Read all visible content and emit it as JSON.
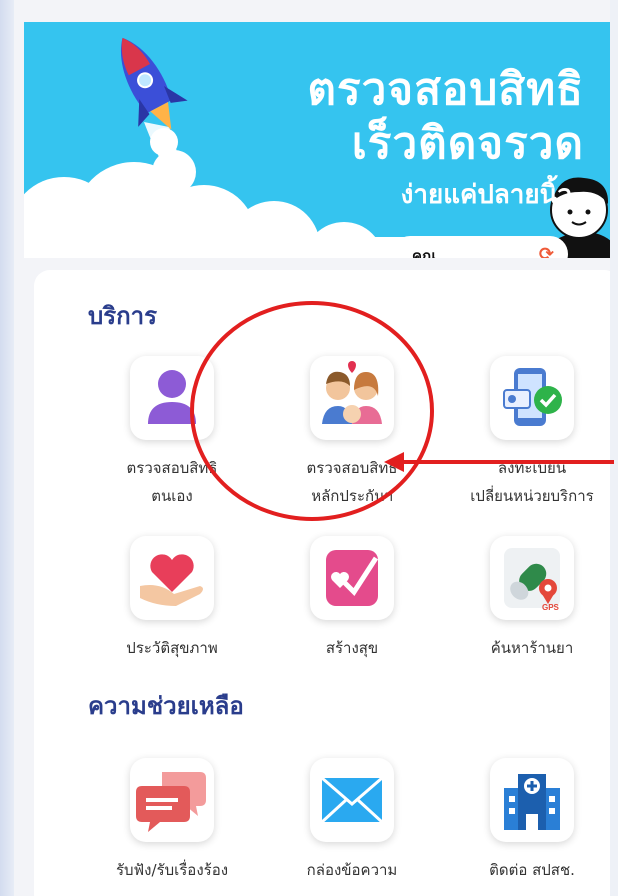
{
  "banner": {
    "title_line1": "ตรวจสอบสิทธิ",
    "title_line2": "เร็วติดจรวด",
    "subtitle": "ง่ายแค่ปลายนิ้ว",
    "pill_text": "คุณ...",
    "pill_icon": "refresh-icon"
  },
  "services": {
    "title": "บริการ",
    "items": [
      {
        "line1": "ตรวจสอบสิทธิ",
        "line2": "ตนเอง",
        "icon": "person-icon"
      },
      {
        "line1": "ตรวจสอบสิทธิ",
        "line2": "หลักประกันฯ",
        "icon": "family-icon"
      },
      {
        "line1": "ลงทะเบียน",
        "line2": "เปลี่ยนหน่วยบริการ",
        "icon": "phone-id-check-icon"
      },
      {
        "line1": "ประวัติสุขภาพ",
        "line2": "",
        "icon": "heart-hand-icon"
      },
      {
        "line1": "สร้างสุข",
        "line2": "",
        "icon": "heart-check-icon"
      },
      {
        "line1": "ค้นหาร้านยา",
        "line2": "",
        "icon": "pill-gps-icon"
      }
    ]
  },
  "help": {
    "title": "ความช่วยเหลือ",
    "items": [
      {
        "line1": "รับฟัง/รับเรื่องร้อง",
        "icon": "chat-bubbles-icon"
      },
      {
        "line1": "กล่องข้อความ",
        "icon": "envelope-icon"
      },
      {
        "line1": "ติดต่อ สปสช.",
        "icon": "hospital-icon"
      }
    ]
  },
  "annotation": {
    "circle_color": "#e21f1f",
    "arrow_color": "#e21f1f"
  }
}
